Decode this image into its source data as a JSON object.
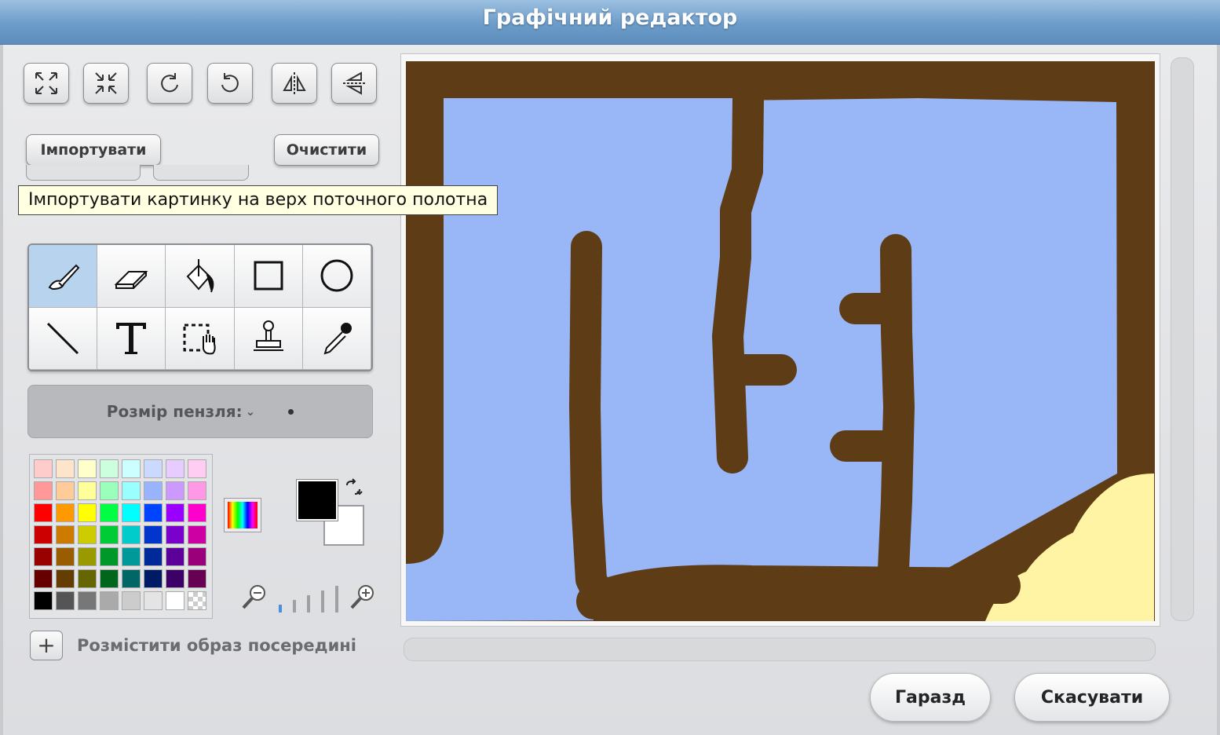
{
  "window": {
    "title": "Графічний редактор"
  },
  "toolbar": {
    "top_icons": [
      "grow-icon",
      "shrink-icon",
      "rotate-ccw-icon",
      "rotate-cw-icon",
      "flip-horizontal-icon",
      "flip-vertical-icon"
    ],
    "import_label": "Імпортувати",
    "clear_label": "Очистити",
    "tooltip": "Імпортувати картинку на верх поточного полотна"
  },
  "tools": {
    "items": [
      "paintbrush",
      "eraser",
      "fill",
      "rectangle",
      "ellipse",
      "line",
      "text",
      "select",
      "stamp",
      "eyedropper"
    ],
    "active": "paintbrush"
  },
  "brush": {
    "label": "Розмір пензля:"
  },
  "palette": {
    "colors": [
      "#ffcccc",
      "#ffe4cc",
      "#ffffcc",
      "#ccffdd",
      "#ccffff",
      "#ccd9ff",
      "#e6ccff",
      "#ffccf2",
      "#ff9999",
      "#ffcc99",
      "#ffff99",
      "#99ffbb",
      "#99ffff",
      "#99b3ff",
      "#cc99ff",
      "#ff99e6",
      "#ff0000",
      "#ff9900",
      "#ffff00",
      "#00ff44",
      "#00ffff",
      "#0044ff",
      "#9900ff",
      "#ff00cc",
      "#cc0000",
      "#cc7a00",
      "#cccc00",
      "#00cc36",
      "#00cccc",
      "#0036cc",
      "#7a00cc",
      "#cc00a3",
      "#990000",
      "#995c00",
      "#999900",
      "#009929",
      "#009999",
      "#002999",
      "#5c0099",
      "#99007a",
      "#660000",
      "#663d00",
      "#666600",
      "#00661b",
      "#006666",
      "#001b66",
      "#3d0066",
      "#660052",
      "#000000",
      "#555555",
      "#777777",
      "#aaaaaa",
      "#cccccc",
      "#e4e4e4",
      "#ffffff",
      "transparent"
    ],
    "foreground": "#000000",
    "background": "#ffffff"
  },
  "canvas": {
    "sky_color": "#99b7f6",
    "wall_color": "#5e3c15",
    "sand_color": "#fff4a3"
  },
  "options": {
    "center_label": "Розмістити образ посередині"
  },
  "dialog": {
    "ok_label": "Гаразд",
    "cancel_label": "Скасувати"
  }
}
